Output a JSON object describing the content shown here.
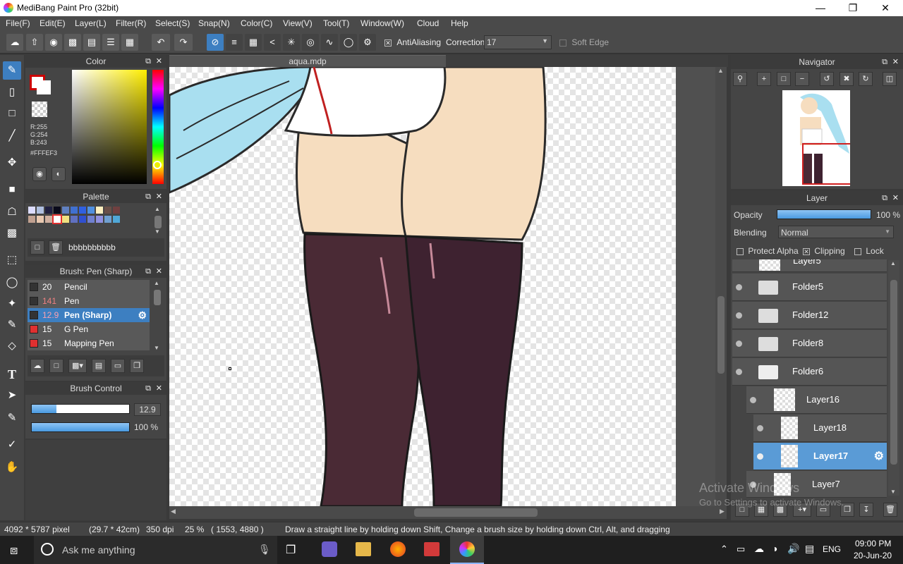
{
  "window": {
    "title": "MediBang Paint Pro (32bit)"
  },
  "menu": [
    "File(F)",
    "Edit(E)",
    "Layer(L)",
    "Filter(R)",
    "Select(S)",
    "Snap(N)",
    "Color(C)",
    "View(V)",
    "Tool(T)",
    "Window(W)",
    "Cloud",
    "Help"
  ],
  "toolbar": {
    "antialiasing_label": "AntiAliasing",
    "correction_label": "Correction",
    "correction_value": "17",
    "soft_edge_label": "Soft Edge"
  },
  "color_panel": {
    "title": "Color",
    "r": "R:255",
    "g": "G:254",
    "b": "B:243",
    "hex": "#FFFEF3",
    "accent": "#3d7fc1"
  },
  "palette_panel": {
    "title": "Palette",
    "name": "bbbbbbbbbb",
    "colors": [
      "#dcdcff",
      "#b0c0e0",
      "#202040",
      "#0a0a1a",
      "#6080c0",
      "#4070d0",
      "#3060e0",
      "#5090e0",
      "#fff0c0",
      "#6a5048",
      "#704040",
      "#c0a090",
      "#e8c8b0",
      "#d0b0a0",
      "#ffffff",
      "#f0e080",
      "#6070c0",
      "#3050d0",
      "#7080d0",
      "#9090e0",
      "#70a0d0",
      "#50a8d8"
    ]
  },
  "brush_panel": {
    "title": "Brush: Pen (Sharp)",
    "items": [
      {
        "size": "20",
        "name": "Pencil",
        "chip": "#333333"
      },
      {
        "size": "141",
        "name": "Pen",
        "chip": "#333333"
      },
      {
        "size": "12.9",
        "name": "Pen (Sharp)",
        "chip": "#333333"
      },
      {
        "size": "15",
        "name": "G Pen",
        "chip": "#e03030"
      },
      {
        "size": "15",
        "name": "Mapping Pen",
        "chip": "#e03030"
      }
    ]
  },
  "brush_control": {
    "title": "Brush Control",
    "size_value": "12.9",
    "opacity_value": "100 %",
    "size_fraction": 0.25,
    "opacity_fraction": 1.0
  },
  "document": {
    "tab": "aqua.mdp"
  },
  "navigator": {
    "title": "Navigator"
  },
  "layer_panel": {
    "title": "Layer",
    "opacity_label": "Opacity",
    "opacity_value": "100 %",
    "blending_label": "Blending",
    "blending_value": "Normal",
    "protect_alpha": "Protect Alpha",
    "clipping": "Clipping",
    "lock": "Lock",
    "partial_layer": "Layer5",
    "layers": [
      {
        "name": "Folder5",
        "type": "folder"
      },
      {
        "name": "Folder12",
        "type": "folder"
      },
      {
        "name": "Folder8",
        "type": "folder"
      },
      {
        "name": "Folder6",
        "type": "folder-open"
      },
      {
        "name": "Layer16",
        "type": "layer"
      },
      {
        "name": "Layer18",
        "type": "layer"
      },
      {
        "name": "Layer17",
        "type": "layer",
        "selected": true
      },
      {
        "name": "Layer7",
        "type": "layer"
      }
    ]
  },
  "watermark": {
    "line1": "Activate Windows",
    "line2": "Go to Settings to activate Windows."
  },
  "status": {
    "size": "4092 * 5787 pixel",
    "cm": "(29.7 * 42cm)",
    "dpi": "350 dpi",
    "zoom": "25 %",
    "coords": "( 1553, 4880 )",
    "hint": "Draw a straight line by holding down Shift, Change a brush size by holding down Ctrl, Alt, and dragging"
  },
  "taskbar": {
    "search_placeholder": "Ask me anything",
    "lang": "ENG",
    "time": "09:00 PM",
    "date": "20-Jun-20"
  }
}
